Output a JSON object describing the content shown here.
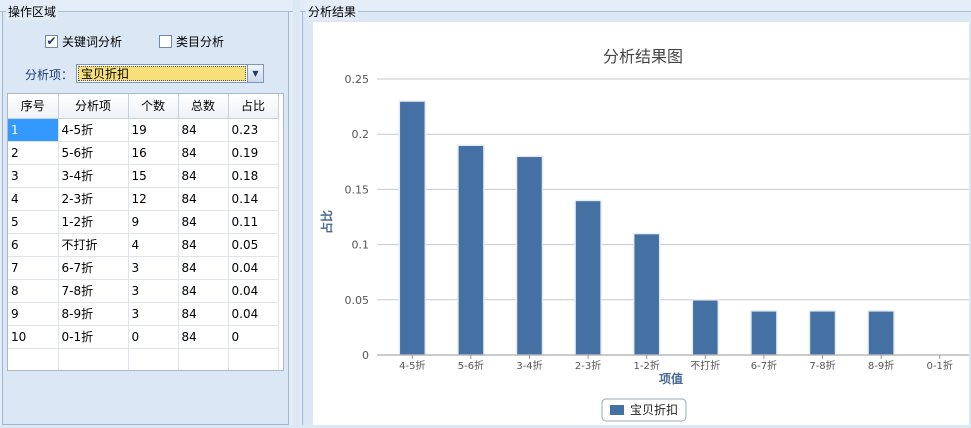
{
  "left_panel": {
    "title": "操作区域",
    "keyword_checkbox": {
      "label": "关键词分析",
      "checked": true
    },
    "category_checkbox": {
      "label": "类目分析",
      "checked": false
    },
    "field_label": "分析项：",
    "select_value": "宝贝折扣"
  },
  "table": {
    "columns": [
      "序号",
      "分析项",
      "个数",
      "总数",
      "占比"
    ],
    "rows": [
      [
        "1",
        "4-5折",
        "19",
        "84",
        "0.23"
      ],
      [
        "2",
        "5-6折",
        "16",
        "84",
        "0.19"
      ],
      [
        "3",
        "3-4折",
        "15",
        "84",
        "0.18"
      ],
      [
        "4",
        "2-3折",
        "12",
        "84",
        "0.14"
      ],
      [
        "5",
        "1-2折",
        "9",
        "84",
        "0.11"
      ],
      [
        "6",
        "不打折",
        "4",
        "84",
        "0.05"
      ],
      [
        "7",
        "6-7折",
        "3",
        "84",
        "0.04"
      ],
      [
        "8",
        "7-8折",
        "3",
        "84",
        "0.04"
      ],
      [
        "9",
        "8-9折",
        "3",
        "84",
        "0.04"
      ],
      [
        "10",
        "0-1折",
        "0",
        "84",
        "0"
      ]
    ]
  },
  "right_panel": {
    "title": "分析结果"
  },
  "chart_data": {
    "type": "bar",
    "title": "分析结果图",
    "xlabel": "项值",
    "ylabel": "占比",
    "categories": [
      "4-5折",
      "5-6折",
      "3-4折",
      "2-3折",
      "1-2折",
      "不打折",
      "6-7折",
      "7-8折",
      "8-9折",
      "0-1折"
    ],
    "series": [
      {
        "name": "宝贝折扣",
        "values": [
          0.23,
          0.19,
          0.18,
          0.14,
          0.11,
          0.05,
          0.04,
          0.04,
          0.04,
          0
        ]
      }
    ],
    "ylim": [
      0,
      0.25
    ],
    "yticks": [
      "0",
      "0.05",
      "0.1",
      "0.15",
      "0.2",
      "0.25"
    ],
    "grid": true,
    "legend_position": "bottom",
    "bar_color": "#4570a3"
  }
}
